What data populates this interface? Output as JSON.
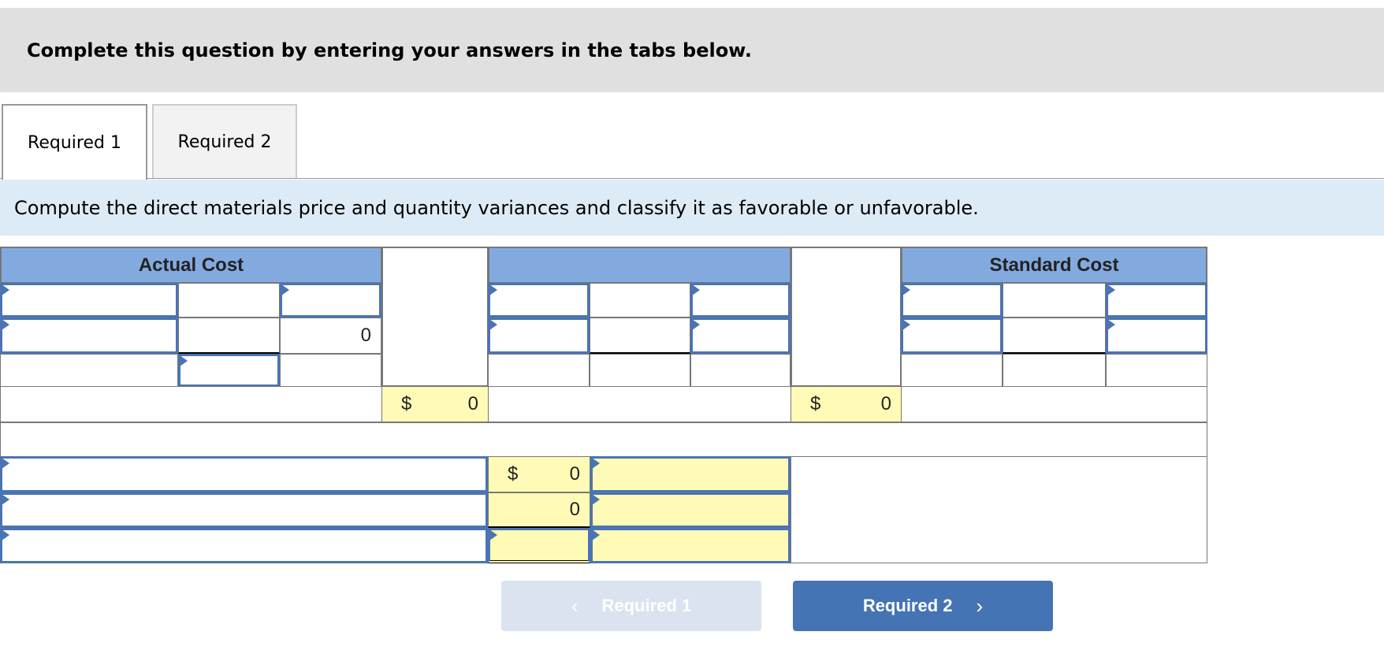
{
  "banner": {
    "text": "Complete this question by entering your answers in the tabs below."
  },
  "tabs": [
    {
      "label": "Required 1",
      "active": true
    },
    {
      "label": "Required 2",
      "active": false
    }
  ],
  "instruction": "Compute the direct materials price and quantity variances and classify it as favorable or unfavorable.",
  "table": {
    "headers": {
      "actual": "Actual Cost",
      "middle": "",
      "standard": "Standard Cost"
    },
    "actual": {
      "row2_value": "0"
    },
    "totals": {
      "actual_total": {
        "currency": "$",
        "value": "0"
      },
      "middle_total": {
        "currency": "$",
        "value": "0"
      }
    },
    "variances": [
      {
        "currency": "$",
        "value": "0"
      },
      {
        "currency": "",
        "value": "0"
      },
      {
        "currency": "",
        "value": ""
      }
    ]
  },
  "nav": {
    "prev_label": "Required 1",
    "next_label": "Required 2",
    "prev_icon": "chevron-left-icon",
    "next_icon": "chevron-right-icon"
  },
  "colors": {
    "header_blue": "#82aadf",
    "input_border": "#4a74b3",
    "yellow_cell": "#fffbb6",
    "next_button": "#4574b4",
    "prev_button_disabled": "#dae3ef",
    "instruction_bg": "#ddebf7",
    "banner_bg": "#e0e0e0"
  }
}
